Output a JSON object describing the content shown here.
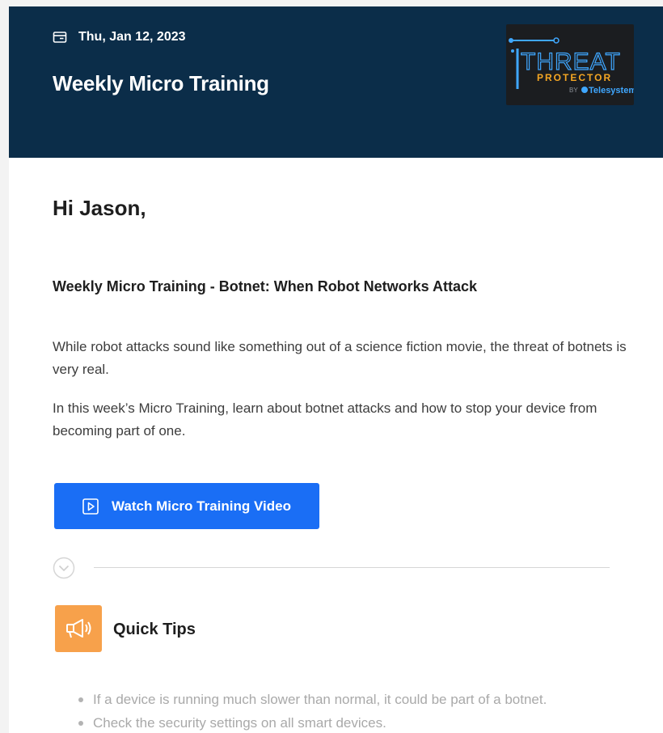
{
  "header": {
    "date": "Thu, Jan 12, 2023",
    "title": "Weekly Micro Training",
    "logo": {
      "line1": "THREAT",
      "line2": "PROTECTOR",
      "byline_prefix": "BY",
      "brand": "Telesystem"
    }
  },
  "body": {
    "greeting": "Hi Jason,",
    "subject": "Weekly Micro Training - Botnet: When Robot Networks Attack",
    "paragraphs": [
      "While robot attacks sound like something out of a science fiction movie, the threat of botnets is very real.",
      "In this week’s Micro Training, learn about botnet attacks and how to stop your device from becoming part of one."
    ],
    "cta_label": "Watch Micro Training Video"
  },
  "tips": {
    "title": "Quick Tips",
    "items": [
      "If a device is running much slower than normal, it could be part of a botnet.",
      "Check the security settings on all smart devices."
    ]
  },
  "colors": {
    "header_bg": "#0b2d49",
    "cta_bg": "#1a6ef5",
    "tips_icon_bg": "#f7a14b",
    "logo_accent": "#f5a623",
    "logo_blue": "#3fa7ff"
  },
  "icons": {
    "date": "calendar-icon",
    "cta": "play-icon",
    "divider": "chevron-down-circle-icon",
    "tips": "megaphone-icon"
  }
}
